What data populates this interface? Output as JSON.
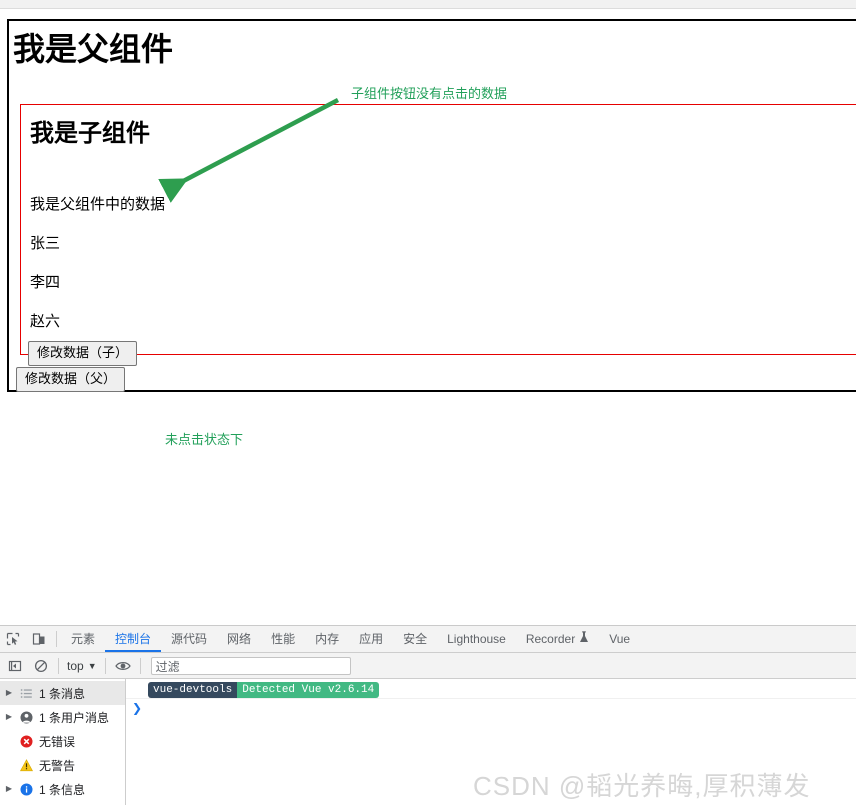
{
  "page": {
    "parent": {
      "title": "我是父组件",
      "button_label": "修改数据（父）"
    },
    "child": {
      "title": "我是子组件",
      "lines": [
        "我是父组件中的数据",
        "张三",
        "李四",
        "赵六"
      ],
      "button_label": "修改数据（子）"
    },
    "annotations": {
      "top_note": "子组件按钮没有点击的数据",
      "button_note": "未点击状态下",
      "color": "#22a05a",
      "child_border_color": "#e60000"
    }
  },
  "devtools": {
    "icons": {
      "inspect": "inspect-element-icon",
      "device": "device-toolbar-icon",
      "sidebar": "sidebar-toggle-icon",
      "clear": "clear-console-icon",
      "eye": "live-expression-eye-icon",
      "recorder_flask": "flask-icon"
    },
    "tabs": [
      {
        "label": "元素",
        "active": false
      },
      {
        "label": "控制台",
        "active": true
      },
      {
        "label": "源代码",
        "active": false
      },
      {
        "label": "网络",
        "active": false
      },
      {
        "label": "性能",
        "active": false
      },
      {
        "label": "内存",
        "active": false
      },
      {
        "label": "应用",
        "active": false
      },
      {
        "label": "安全",
        "active": false
      },
      {
        "label": "Lighthouse",
        "active": false
      },
      {
        "label": "Recorder",
        "active": false
      },
      {
        "label": "Vue",
        "active": false
      }
    ],
    "filterbar": {
      "context": "top",
      "context_caret": "▼",
      "filter_placeholder": "过滤"
    },
    "sidebar": [
      {
        "label": "1 条消息",
        "icon": "list-icon",
        "caret": "▶",
        "selected": true
      },
      {
        "label": "1 条用户消息",
        "icon": "user-icon",
        "caret": "▶",
        "selected": false
      },
      {
        "label": "无错误",
        "icon": "error-icon",
        "caret": "",
        "selected": false
      },
      {
        "label": "无警告",
        "icon": "warning-icon",
        "caret": "",
        "selected": false
      },
      {
        "label": "1 条信息",
        "icon": "info-icon",
        "caret": "▶",
        "selected": false
      }
    ],
    "console": {
      "message_tag": "vue-devtools",
      "message_text": "Detected Vue v2.6.14",
      "prompt": "❯"
    }
  },
  "watermark": "CSDN @韬光养晦,厚积薄发"
}
